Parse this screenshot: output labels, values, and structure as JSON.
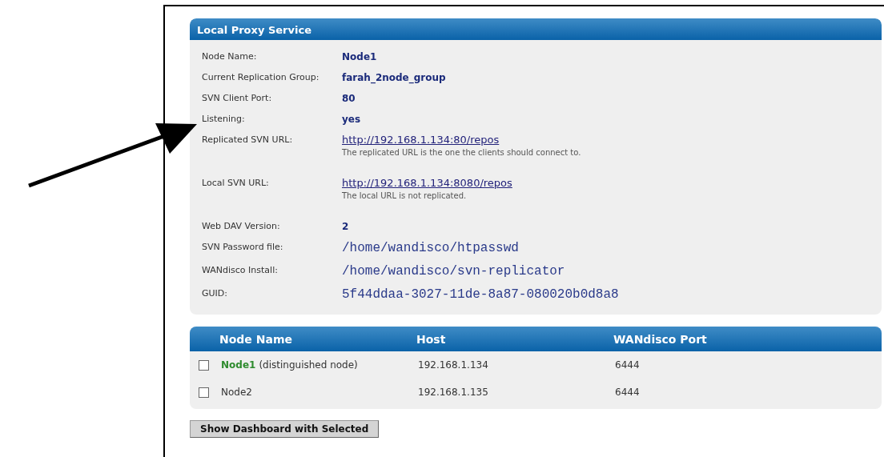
{
  "service": {
    "title": "Local Proxy Service",
    "fields": [
      {
        "label": "Node Name:",
        "kind": "text",
        "value": "Node1"
      },
      {
        "label": "Current Replication Group:",
        "kind": "text",
        "value": "farah_2node_group"
      },
      {
        "label": "SVN Client Port:",
        "kind": "text",
        "value": "80"
      },
      {
        "label": "Listening:",
        "kind": "text",
        "value": "yes"
      },
      {
        "label": "Replicated SVN URL:",
        "kind": "link",
        "value": "http://192.168.1.134:80/repos",
        "note": "The replicated URL is the one the clients should connect to."
      },
      {
        "label": "Local SVN URL:",
        "kind": "link",
        "value": "http://192.168.1.134:8080/repos",
        "note": "The local URL is not replicated."
      },
      {
        "label": "Web DAV Version:",
        "kind": "text",
        "value": "2"
      },
      {
        "label": "SVN Password file:",
        "kind": "code",
        "value": "/home/wandisco/htpasswd"
      },
      {
        "label": "WANdisco Install:",
        "kind": "code",
        "value": "/home/wandisco/svn-replicator"
      },
      {
        "label": "GUID:",
        "kind": "code",
        "value": "5f44ddaa-3027-11de-8a87-080020b0d8a8"
      }
    ]
  },
  "nodes": {
    "columns": [
      "Node Name",
      "Host",
      "WANdisco Port"
    ],
    "rows": [
      {
        "checked": false,
        "distinguished": true,
        "name": "Node1",
        "note": "(distinguished node)",
        "host": "192.168.1.134",
        "port": "6444"
      },
      {
        "checked": false,
        "distinguished": false,
        "name": "Node2",
        "host": "192.168.1.135",
        "port": "6444"
      }
    ]
  },
  "button": "Show Dashboard with Selected"
}
